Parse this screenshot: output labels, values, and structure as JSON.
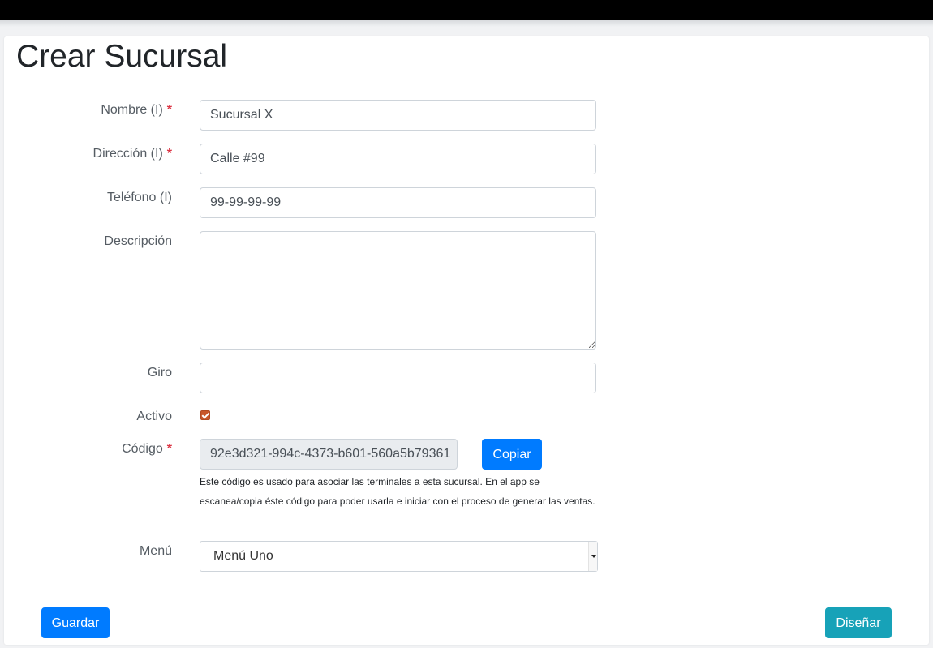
{
  "page": {
    "title": "Crear Sucursal"
  },
  "form": {
    "nombre": {
      "label": "Nombre (I)",
      "required": "*",
      "value": "Sucursal X"
    },
    "direccion": {
      "label": "Dirección (I)",
      "required": "*",
      "value": "Calle #99"
    },
    "telefono": {
      "label": "Teléfono (I)",
      "value": "99-99-99-99"
    },
    "descripcion": {
      "label": "Descripción",
      "value": ""
    },
    "giro": {
      "label": "Giro",
      "value": ""
    },
    "activo": {
      "label": "Activo",
      "checked": true
    },
    "codigo": {
      "label": "Código",
      "required": "*",
      "value": "92e3d321-994c-4373-b601-560a5b79361",
      "copy_label": "Copiar",
      "help": "Este código es usado para asociar las terminales a esta sucursal. En el app se escanea/copia éste código para poder usarla e iniciar con el proceso de generar las ventas."
    },
    "menu": {
      "label": "Menú",
      "selected": "Menú Uno"
    }
  },
  "actions": {
    "save_label": "Guardar",
    "design_label": "Diseñar"
  },
  "colors": {
    "primary": "#007bff",
    "info": "#17a2b8",
    "required": "#dc3545",
    "checkbox": "#c8562a"
  }
}
